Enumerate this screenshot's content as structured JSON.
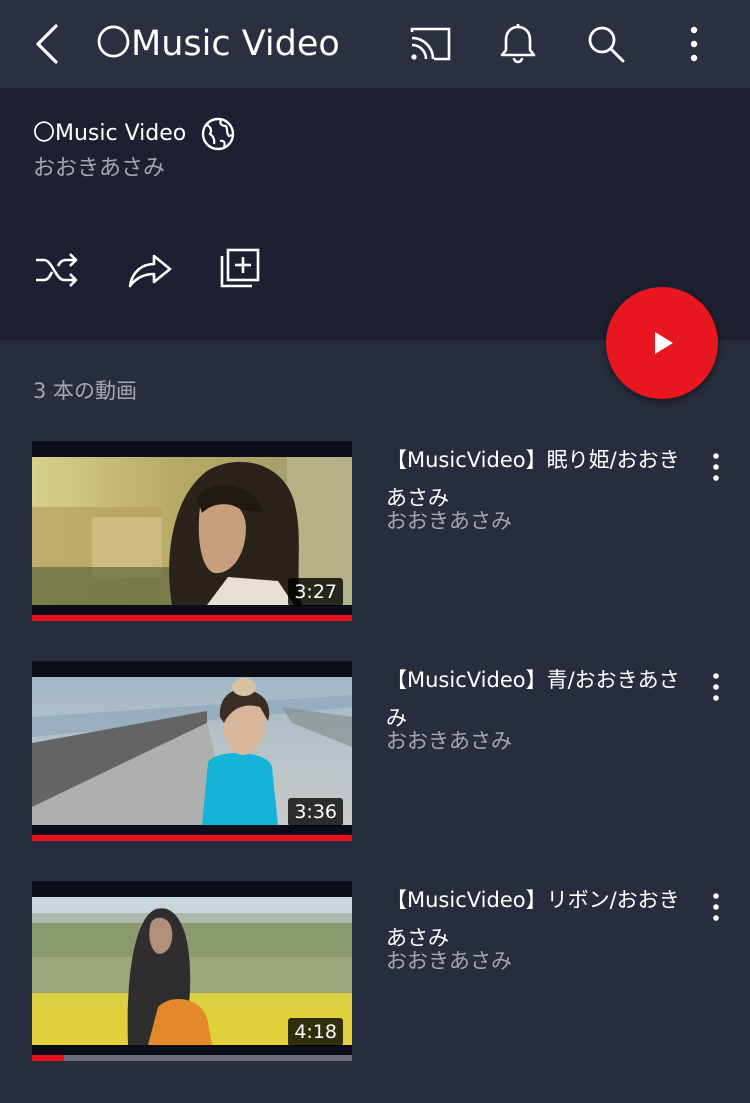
{
  "appbar": {
    "title": "〇Music Video",
    "icons": [
      "back-icon",
      "cast-icon",
      "bell-icon",
      "search-icon",
      "more-vert-icon"
    ]
  },
  "playlist": {
    "title": "〇Music Video",
    "owner": "おおきあさみ",
    "visibility_icon": "globe-icon",
    "actions": [
      "shuffle-icon",
      "share-icon",
      "add-to-library-icon"
    ],
    "video_count": "3 本の動画"
  },
  "videos": [
    {
      "title": "【MusicVideo】眠り姫/おおきあさみ",
      "channel": "おおきあさみ",
      "duration": "3:27",
      "watched_fraction": 1.0
    },
    {
      "title": "【MusicVideo】青/おおきあさみ",
      "channel": "おおきあさみ",
      "duration": "3:36",
      "watched_fraction": 1.0
    },
    {
      "title": "【MusicVideo】リボン/おおきあさみ",
      "channel": "おおきあさみ",
      "duration": "4:18",
      "watched_fraction": 0.1
    }
  ],
  "colors": {
    "appbar_bg": "#2b3040",
    "header_bg": "#1d2030",
    "list_bg": "#282d3d",
    "accent_red": "#e7161f",
    "secondary_text": "#a3a6b2"
  }
}
